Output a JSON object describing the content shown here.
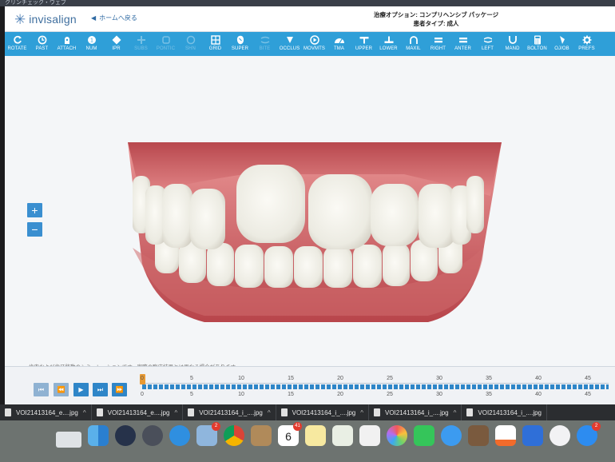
{
  "titlebar": {
    "text": "クリンチェック・ウェブ"
  },
  "header": {
    "logo_text": "invisalign",
    "home_label": "ホームへ戻る",
    "treatment_option": "治療オプション: コンプリヘンシブ パッケージ",
    "patient_type": "患者タイプ: 成人"
  },
  "toolbar": {
    "items": [
      {
        "label": "ROTATE",
        "icon": "rotate-icon"
      },
      {
        "label": "PAST",
        "icon": "past-icon"
      },
      {
        "label": "ATTACH",
        "icon": "attach-icon"
      },
      {
        "label": "NUM",
        "icon": "number-icon"
      },
      {
        "label": "IPR",
        "icon": "ipr-icon"
      },
      {
        "label": "SUBS",
        "icon": "plus-icon"
      },
      {
        "label": "PONTIC",
        "icon": "pontic-icon"
      },
      {
        "label": "SHN",
        "icon": "shn-icon"
      },
      {
        "label": "GRID",
        "icon": "grid-icon"
      },
      {
        "label": "SUPER",
        "icon": "super-icon"
      },
      {
        "label": "BITE",
        "icon": "bite-icon"
      },
      {
        "label": "OCCLUS",
        "icon": "occlus-icon"
      },
      {
        "label": "MOVMTS",
        "icon": "movements-icon"
      },
      {
        "label": "TMA",
        "icon": "tma-icon"
      },
      {
        "label": "UPPER",
        "icon": "upper-icon"
      },
      {
        "label": "LOWER",
        "icon": "lower-icon"
      },
      {
        "label": "MAXIL",
        "icon": "maxil-icon"
      },
      {
        "label": "RIGHT",
        "icon": "right-icon"
      },
      {
        "label": "ANTER",
        "icon": "anter-icon"
      },
      {
        "label": "LEFT",
        "icon": "left-icon"
      },
      {
        "label": "MAND",
        "icon": "mand-icon"
      },
      {
        "label": "BOLTON",
        "icon": "bolton-icon"
      },
      {
        "label": "OJ/OB",
        "icon": "ojob-icon"
      },
      {
        "label": "PREFS",
        "icon": "prefs-icon"
      }
    ]
  },
  "viewport": {
    "zoom_in": "+",
    "zoom_out": "−",
    "disclaimer": "歯肉および歯牙移動のシミュレーションです。実際の臨床結果とは異なる場合があります。"
  },
  "timeline": {
    "ticks": [
      "0",
      "5",
      "10",
      "15",
      "20",
      "25",
      "30",
      "35",
      "40",
      "45"
    ],
    "current_stage": 0
  },
  "downloads": [
    {
      "name": "VOI21413164_e....jpg"
    },
    {
      "name": "VOI21413164_e....jpg"
    },
    {
      "name": "VOI21413164_i_....jpg"
    },
    {
      "name": "VOI21413164_i_....jpg"
    },
    {
      "name": "VOI21413164_i_....jpg"
    },
    {
      "name": "VOI21413164_i_....jpg"
    }
  ],
  "dock": {
    "calendar_date": "6",
    "badges": {
      "photos": "2",
      "calendar": "41",
      "appstore": "2"
    }
  }
}
